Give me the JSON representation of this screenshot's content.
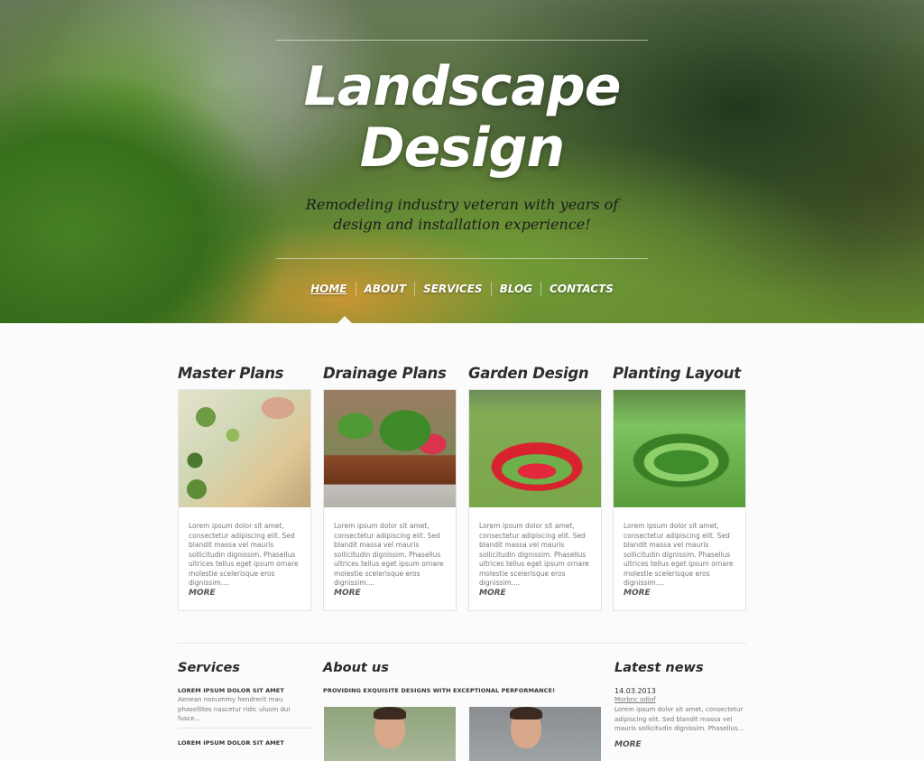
{
  "hero": {
    "title_line1": "Landscape",
    "title_line2": "Design",
    "subtitle_line1": "Remodeling industry veteran with years of",
    "subtitle_line2": "design and installation experience!"
  },
  "nav": {
    "items": [
      {
        "label": "HOME",
        "active": true
      },
      {
        "label": "ABOUT"
      },
      {
        "label": "SERVICES"
      },
      {
        "label": "BLOG"
      },
      {
        "label": "CONTACTS"
      }
    ]
  },
  "cards": [
    {
      "title": "Master Plans",
      "text": "Lorem ipsum dolor sit amet, consectetur adipiscing elit. Sed blandit massa vel mauris sollicitudin dignissim. Phasellus ultrices tellus eget ipsum ornare molestie scelerisque eros dignissim....",
      "more": "MORE"
    },
    {
      "title": "Drainage Plans",
      "text": "Lorem ipsum dolor sit amet, consectetur adipiscing elit. Sed blandit massa vel mauris sollicitudin dignissim. Phasellus ultrices tellus eget ipsum ornare molestie scelerisque eros dignissim....",
      "more": "MORE"
    },
    {
      "title": "Garden Design",
      "text": "Lorem ipsum dolor sit amet, consectetur adipiscing elit. Sed blandit massa vel mauris sollicitudin dignissim. Phasellus ultrices tellus eget ipsum ornare molestie scelerisque eros dignissim....",
      "more": "MORE"
    },
    {
      "title": "Planting Layout",
      "text": "Lorem ipsum dolor sit amet, consectetur adipiscing elit. Sed blandit massa vel mauris sollicitudin dignissim. Phasellus ultrices tellus eget ipsum ornare molestie scelerisque eros dignissim....",
      "more": "MORE"
    }
  ],
  "services": {
    "title": "Services",
    "items": [
      {
        "heading": "LOREM IPSUM DOLOR SIT AMET",
        "text": "Aenean nonummy hendrerit mau phasellites nascetur ridic ulusm dui fusce..."
      },
      {
        "heading": "LOREM IPSUM DOLOR SIT AMET"
      }
    ]
  },
  "about": {
    "title": "About us",
    "tagline": "PROVIDING EXQUISITE DESIGNS WITH EXCEPTIONAL PERFORMANCE!"
  },
  "news": {
    "title": "Latest news",
    "date": "14.03.2013",
    "link": "Morbnc odiof",
    "text": "Lorem ipsum dolor sit amet, consectetur adipiscing elit. Sed blandit massa vel mauris sollicitudin dignissim. Phasellus...",
    "more": "MORE"
  }
}
